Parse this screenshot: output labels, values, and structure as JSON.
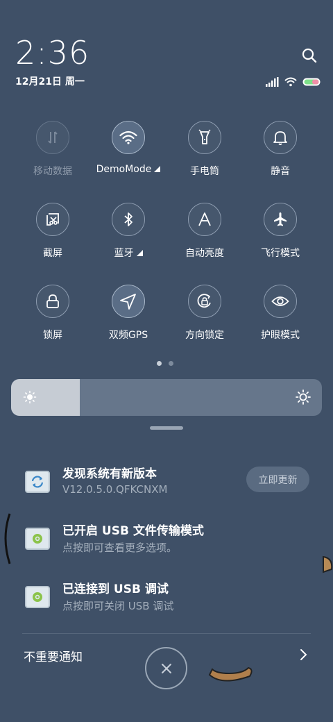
{
  "status_bar": {
    "time": "2:36",
    "date": "12月21日 周一"
  },
  "quick_toggles": [
    {
      "label": "移动数据",
      "icon": "mobile-data-icon",
      "state": "disabled"
    },
    {
      "label": "DemoMode",
      "icon": "wifi-icon",
      "state": "on",
      "has_submenu": true
    },
    {
      "label": "手电筒",
      "icon": "flashlight-icon",
      "state": "off"
    },
    {
      "label": "静音",
      "icon": "bell-icon",
      "state": "off"
    },
    {
      "label": "截屏",
      "icon": "screenshot-icon",
      "state": "off"
    },
    {
      "label": "蓝牙",
      "icon": "bluetooth-icon",
      "state": "off",
      "has_submenu": true
    },
    {
      "label": "自动亮度",
      "icon": "auto-brightness-icon",
      "state": "off"
    },
    {
      "label": "飞行模式",
      "icon": "airplane-icon",
      "state": "off"
    },
    {
      "label": "锁屏",
      "icon": "lock-icon",
      "state": "off"
    },
    {
      "label": "双频GPS",
      "icon": "location-arrow-icon",
      "state": "on"
    },
    {
      "label": "方向锁定",
      "icon": "rotation-lock-icon",
      "state": "off"
    },
    {
      "label": "护眼模式",
      "icon": "eye-icon",
      "state": "off"
    }
  ],
  "page_indicator": {
    "current": 1,
    "total": 2
  },
  "brightness": {
    "level": 0.22
  },
  "notifications": [
    {
      "title": "发现系统有新版本",
      "subtitle": "V12.0.5.0.QFKCNXM",
      "action": "立即更新",
      "icon": "system-update-icon"
    },
    {
      "title": "已开启 USB 文件传输模式",
      "subtitle": "点按即可查看更多选项。",
      "icon": "android-system-icon"
    },
    {
      "title": "已连接到 USB 调试",
      "subtitle": "点按即可关闭 USB 调试",
      "icon": "android-system-icon"
    }
  ],
  "footer": {
    "unimportant_label": "不重要通知"
  },
  "colors": {
    "background": "#3f5067",
    "toggle_on": "#5a6d86",
    "accent_battery": "#7ee08a"
  }
}
